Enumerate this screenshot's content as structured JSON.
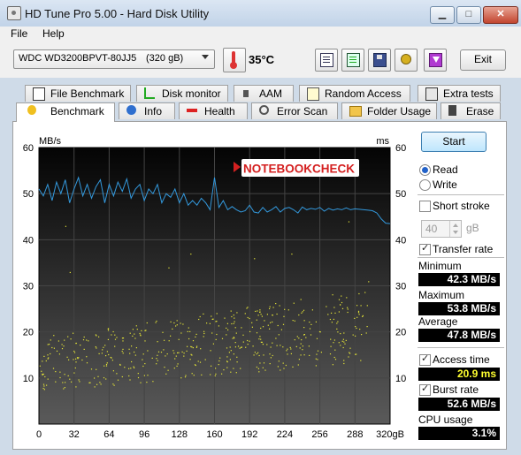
{
  "window": {
    "title": "HD Tune Pro 5.00 - Hard Disk Utility",
    "controls": {
      "minimize": "▁",
      "maximize": "□",
      "close": "✕"
    }
  },
  "menu": {
    "file": "File",
    "help": "Help"
  },
  "toolbar": {
    "drive_model": "WDC WD3200BPVT-80JJ5",
    "drive_size": "(320 gB)",
    "temperature": "35°C",
    "exit_label": "Exit",
    "icons": [
      "copy-text-icon",
      "copy-screenshot-icon",
      "save-icon",
      "options-icon",
      "exit-download-icon"
    ]
  },
  "tabs_row1": [
    {
      "label": "File Benchmark",
      "icon": "file-benchmark-icon"
    },
    {
      "label": "Disk monitor",
      "icon": "disk-monitor-icon"
    },
    {
      "label": "AAM",
      "icon": "speaker-icon"
    },
    {
      "label": "Random Access",
      "icon": "random-access-icon"
    },
    {
      "label": "Extra tests",
      "icon": "extra-tests-icon"
    }
  ],
  "tabs_row2": [
    {
      "label": "Benchmark",
      "icon": "benchmark-icon",
      "active": true
    },
    {
      "label": "Info",
      "icon": "info-icon"
    },
    {
      "label": "Health",
      "icon": "health-icon"
    },
    {
      "label": "Error Scan",
      "icon": "error-scan-icon"
    },
    {
      "label": "Folder Usage",
      "icon": "folder-icon"
    },
    {
      "label": "Erase",
      "icon": "erase-icon"
    }
  ],
  "panel": {
    "start_label": "Start",
    "read_label": "Read",
    "write_label": "Write",
    "mode_selected": "Read",
    "short_stroke_label": "Short stroke",
    "short_stroke_checked": false,
    "short_stroke_value": "40",
    "short_stroke_unit": "gB",
    "transfer_rate_label": "Transfer rate",
    "transfer_rate_checked": true,
    "minimum_label": "Minimum",
    "minimum_value": "42.3 MB/s",
    "maximum_label": "Maximum",
    "maximum_value": "53.8 MB/s",
    "average_label": "Average",
    "average_value": "47.8 MB/s",
    "access_time_label": "Access time",
    "access_time_checked": true,
    "access_time_value": "20.9 ms",
    "burst_rate_label": "Burst rate",
    "burst_rate_checked": true,
    "burst_rate_value": "52.6 MB/s",
    "cpu_usage_label": "CPU usage",
    "cpu_usage_value": "3.1%"
  },
  "watermark": "NOTEBOOKCHECK",
  "chart_data": {
    "type": "line",
    "left_axis_label": "MB/s",
    "right_axis_label": "ms",
    "x_unit_label": "gB",
    "xlim": [
      0,
      320
    ],
    "ylim": [
      0,
      60
    ],
    "x_ticks": [
      0,
      32,
      64,
      96,
      128,
      160,
      192,
      224,
      256,
      288,
      320
    ],
    "x_tick_labels": [
      "0",
      "32",
      "64",
      "96",
      "128",
      "160",
      "192",
      "224",
      "256",
      "288",
      "320gB"
    ],
    "y_ticks_left": [
      "60",
      "50",
      "40",
      "30",
      "20",
      "10"
    ],
    "y_ticks_right": [
      "60",
      "50",
      "40",
      "30",
      "20",
      "10"
    ],
    "grid": true,
    "series": [
      {
        "kind": "transfer-rate-line",
        "color": "#3399dd",
        "x": [
          0,
          4,
          8,
          12,
          16,
          20,
          24,
          28,
          32,
          36,
          40,
          44,
          48,
          52,
          56,
          60,
          64,
          68,
          72,
          76,
          80,
          84,
          88,
          92,
          96,
          100,
          104,
          108,
          112,
          116,
          120,
          124,
          128,
          132,
          136,
          140,
          144,
          148,
          152,
          156,
          160,
          164,
          168,
          172,
          176,
          180,
          184,
          188,
          192,
          196,
          200,
          204,
          208,
          212,
          216,
          220,
          224,
          228,
          232,
          236,
          240,
          244,
          248,
          252,
          256,
          260,
          264,
          268,
          272,
          276,
          280,
          284,
          288,
          292,
          296,
          300,
          304,
          308,
          312,
          316,
          320
        ],
        "y": [
          51,
          49.5,
          52,
          48.5,
          52.5,
          50,
          53,
          48,
          51,
          53.5,
          49.5,
          52,
          49,
          51.5,
          53,
          48,
          52,
          49.5,
          52.5,
          50.5,
          53.2,
          49,
          51,
          52,
          48.5,
          51,
          50,
          52,
          48,
          50,
          49.2,
          51,
          48,
          50,
          47.5,
          48.5,
          47.5,
          49,
          48,
          46.5,
          53.5,
          47,
          48.5,
          46.5,
          47.2,
          46.5,
          46,
          46.3,
          47.5,
          46,
          45.8,
          47,
          46,
          46.5,
          47.2,
          46,
          46.8,
          47,
          46.5,
          45.8,
          47.1,
          46.5,
          46.8,
          46.6,
          47,
          46.2,
          46.8,
          46.4,
          46.7,
          46.5,
          46.9,
          46.5,
          46.7,
          46.6,
          46.5,
          46.4,
          46.3,
          45.8,
          44.5,
          43.6,
          43.5
        ]
      },
      {
        "kind": "access-time-scatter",
        "color": "#e5e537",
        "y_range_start": [
          7,
          19
        ],
        "y_range_end": [
          14,
          30
        ],
        "outliers": [
          [
            28,
            33
          ],
          [
            118,
            34
          ],
          [
            138,
            37
          ],
          [
            196,
            36
          ],
          [
            230,
            37
          ],
          [
            282,
            44
          ],
          [
            300,
            31
          ],
          [
            24,
            43
          ]
        ]
      }
    ]
  }
}
